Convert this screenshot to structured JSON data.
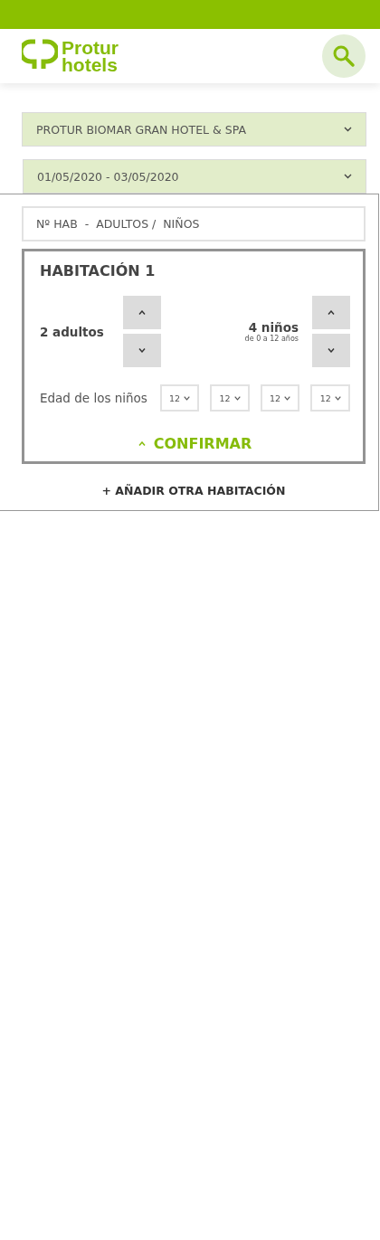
{
  "header": {
    "logo_line_1": "Protur",
    "logo_line_2": "hotels"
  },
  "hotel_select": {
    "value": "PROTUR BIOMAR GRAN HOTEL & SPA"
  },
  "date_select": {
    "value": "01/05/2020 - 03/05/2020"
  },
  "rooms_field": {
    "placeholder": "Nº HAB  -  ADULTOS /  NIÑOS"
  },
  "room": {
    "title": "HABITACIÓN 1",
    "adults": {
      "label": "2 adultos"
    },
    "children": {
      "label": "4 niños",
      "hint": "de 0 a 12 años"
    },
    "ages_label": "Edad de los niños",
    "ages": [
      "12",
      "12",
      "12",
      "12"
    ],
    "confirm": "CONFIRMAR"
  },
  "add_room": "+ AÑADIR OTRA HABITACIÓN"
}
